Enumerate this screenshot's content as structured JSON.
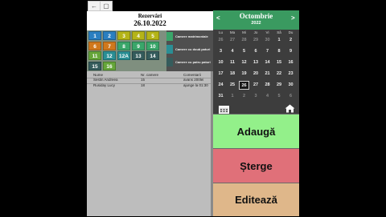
{
  "window": {
    "back_glyph": "←",
    "restore_glyph": "▢"
  },
  "header": {
    "title": "Rezervări",
    "date": "26.10.2022"
  },
  "rooms": [
    {
      "label": "1",
      "color": "blue"
    },
    {
      "label": "2",
      "color": "blue"
    },
    {
      "label": "3",
      "color": "yellow"
    },
    {
      "label": "4",
      "color": "yellow"
    },
    {
      "label": "5",
      "color": "yellow"
    },
    {
      "label": "6",
      "color": "orange"
    },
    {
      "label": "7",
      "color": "orange"
    },
    {
      "label": "8",
      "color": "green"
    },
    {
      "label": "9",
      "color": "green"
    },
    {
      "label": "10",
      "color": "green"
    },
    {
      "label": "11",
      "color": "lime"
    },
    {
      "label": "12",
      "color": "teal"
    },
    {
      "label": "12A",
      "color": "teal"
    },
    {
      "label": "13",
      "color": "dark"
    },
    {
      "label": "14",
      "color": "dark"
    },
    {
      "label": "15",
      "color": "dark"
    },
    {
      "label": "16",
      "color": "lime"
    }
  ],
  "legend": [
    {
      "label": "Camere matrimoniale",
      "color": "#3aa66a"
    },
    {
      "label": "Camere cu două paturi",
      "color": "#2a8f95"
    },
    {
      "label": "Camere cu patru paturi",
      "color": "#355c5c"
    }
  ],
  "table": {
    "headers": [
      "Nume",
      "Nr. camere",
      "Comentarii"
    ],
    "rows": [
      [
        "Sestin Andreea",
        "15",
        "avans 200lei"
      ],
      [
        "Rusiday Lucy",
        "18",
        "ajunge la 01:30"
      ]
    ]
  },
  "calendar": {
    "month": "Octombrie",
    "year": "2022",
    "prev": "<",
    "next": ">",
    "dow": [
      "Lu",
      "Ma",
      "Mi",
      "Jo",
      "Vi",
      "Sâ",
      "Du"
    ],
    "weeks": [
      [
        "26",
        "27",
        "28",
        "29",
        "30",
        "1",
        "2"
      ],
      [
        "3",
        "4",
        "5",
        "6",
        "7",
        "8",
        "9"
      ],
      [
        "10",
        "11",
        "12",
        "13",
        "14",
        "15",
        "16"
      ],
      [
        "17",
        "18",
        "19",
        "20",
        "21",
        "22",
        "23"
      ],
      [
        "24",
        "25",
        "26",
        "27",
        "28",
        "29",
        "30"
      ],
      [
        "31",
        "1",
        "2",
        "3",
        "4",
        "5",
        "6"
      ]
    ],
    "selected": "26",
    "calendar_icon": "calendar-icon",
    "home_icon": "home-icon"
  },
  "actions": {
    "add": {
      "label": "Adaugă",
      "color": "#93f08a"
    },
    "delete": {
      "label": "Șterge",
      "color": "#e07079"
    },
    "edit": {
      "label": "Editează",
      "color": "#dfb78a"
    }
  }
}
